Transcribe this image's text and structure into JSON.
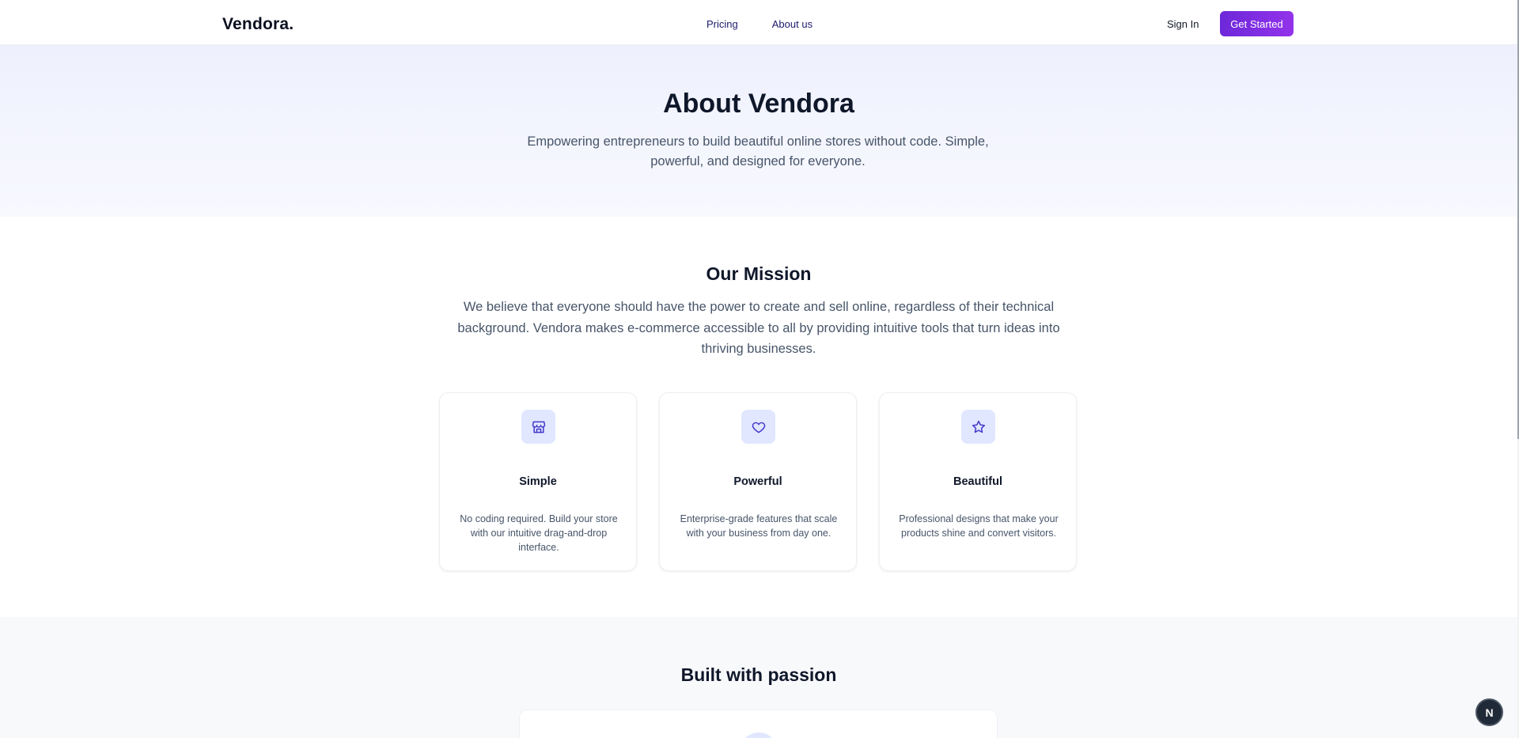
{
  "nav": {
    "logo": "Vendora.",
    "links": [
      "Pricing",
      "About us"
    ],
    "sign_in": "Sign In",
    "get_started": "Get Started"
  },
  "hero": {
    "title": "About Vendora",
    "subtitle": "Empowering entrepreneurs to build beautiful online stores without code. Simple, powerful, and designed for everyone."
  },
  "mission": {
    "title": "Our Mission",
    "text": "We believe that everyone should have the power to create and sell online, regardless of their technical background. Vendora makes e-commerce accessible to all by providing intuitive tools that turn ideas into thriving businesses.",
    "cards": [
      {
        "icon": "store-icon",
        "title": "Simple",
        "desc": "No coding required. Build your store with our intuitive drag-and-drop interface."
      },
      {
        "icon": "heart-icon",
        "title": "Powerful",
        "desc": "Enterprise-grade features that scale with your business from day one."
      },
      {
        "icon": "star-icon",
        "title": "Beautiful",
        "desc": "Professional designs that make your products shine and convert visitors."
      }
    ]
  },
  "passion": {
    "title": "Built with passion"
  },
  "floating_button": {
    "label": "N"
  },
  "colors": {
    "accent": "#7c3aed",
    "icon_bg": "#e0e7ff",
    "icon_stroke": "#4338ca",
    "hero_bg": "#eef0fd"
  }
}
